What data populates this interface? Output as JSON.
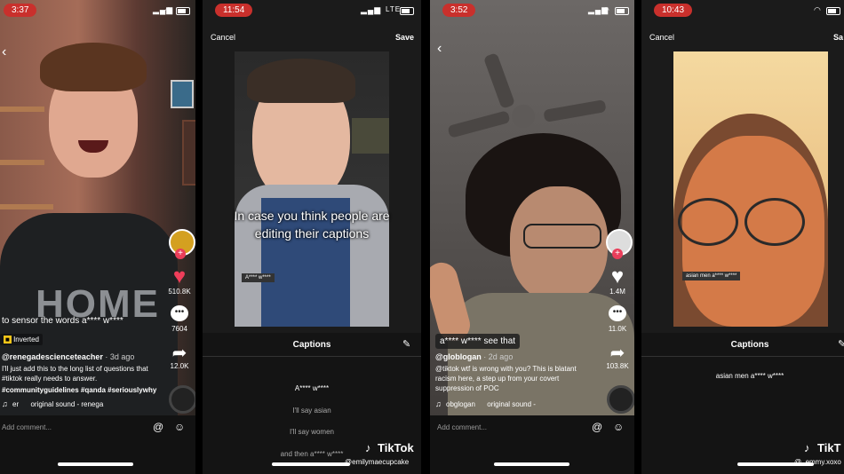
{
  "panel1": {
    "time": "3:37",
    "sensor_text": "to sensor the words a**** w****",
    "effect_label": "Inverted",
    "username": "@renegadescienceteacher",
    "date": "· 3d ago",
    "description": "I'll just add this to the long list of questions that #tiktok really needs to answer.",
    "hashtags": "#communityguidelines #qanda #seriouslywhy",
    "sound": "er      original sound - renega",
    "likes": "510.8K",
    "comments": "7604",
    "shares": "12.0K",
    "add_comment": "Add comment...",
    "shirt_text": "HOME"
  },
  "panel2": {
    "time": "11:54",
    "network": "LTE",
    "cancel": "Cancel",
    "save": "Save",
    "overlay_text": "In case you think people are editing their captions",
    "sticker": "A**** w****",
    "captions_title": "Captions",
    "lines": [
      "A**** w****",
      "I'll say asian",
      "I'll say women",
      "and then a**** w****"
    ],
    "brand": "TikTok",
    "user": "@emilymaecupcake"
  },
  "panel3": {
    "time": "3:52",
    "caption_box": "a**** w**** see that",
    "username": "@globlogan",
    "date": "· 2d ago",
    "description": "@tiktok wtf is wrong with you? This is blatant racism here, a step up from your covert suppression of POC",
    "sound": "obglogan      original sound -",
    "likes": "1.4M",
    "comments": "11.0K",
    "shares": "103.8K",
    "add_comment": "Add comment..."
  },
  "panel4": {
    "time": "10:43",
    "cancel": "Cancel",
    "save": "Sa",
    "sticker": "asian men a**** w****",
    "captions_title": "Captions",
    "line": "asian men a**** w****",
    "brand": "TikT",
    "user": "@_emmy.xoxo"
  }
}
